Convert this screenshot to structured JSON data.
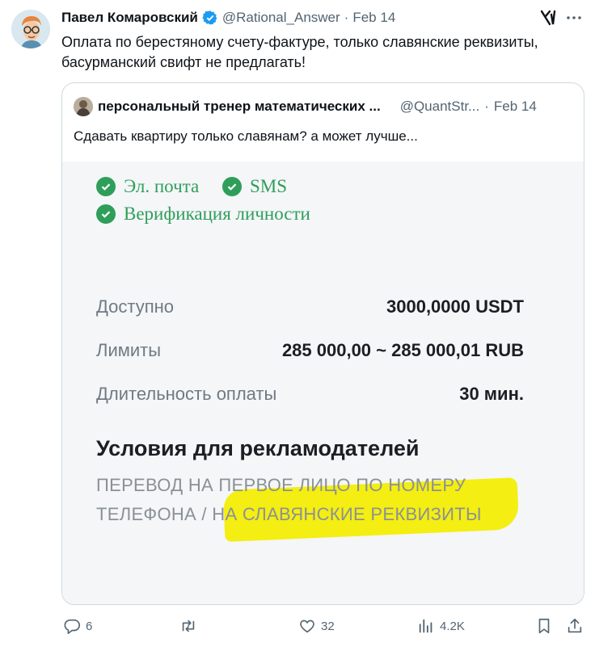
{
  "tweet": {
    "author_name": "Павел Комаровский",
    "handle": "@Rational_Answer",
    "separator": "·",
    "date": "Feb 14",
    "text": "Оплата по берестяному счету-фактуре, только славянские реквизиты, басурманский свифт не предлагать!"
  },
  "quote": {
    "author_name": "персональный тренер математических ...",
    "handle": "@QuantStr...",
    "separator": "·",
    "date": "Feb 14",
    "text": "Сдавать квартиру только славянам? а может лучше..."
  },
  "media": {
    "checks": [
      "Эл. почта",
      "SMS",
      "Верификация личности"
    ],
    "rows": [
      {
        "label": "Доступно",
        "value": "3000,0000 USDT"
      },
      {
        "label": "Лимиты",
        "value": "285 000,00 ~ 285 000,01 RUB"
      },
      {
        "label": "Длительность оплаты",
        "value": "30 мин."
      }
    ],
    "conditions_title": "Условия для рекламодателей",
    "conditions_line1": "ПЕРЕВОД НА ПЕРВОЕ ЛИЦО ПО НОМЕРУ",
    "conditions_line2": "ТЕЛЕФОНА / НА СЛАВЯНСКИЕ РЕКВИЗИТЫ",
    "highlight_color": "#f4ee12",
    "check_color": "#2f9e5a"
  },
  "actions": {
    "replies": "6",
    "likes": "32",
    "views": "4.2K"
  },
  "icons": {
    "verified": "verified-badge-icon",
    "grok": "grok-icon",
    "more": "more-icon",
    "reply": "reply-icon",
    "retweet": "retweet-icon",
    "like": "heart-icon",
    "views": "views-icon",
    "bookmark": "bookmark-icon",
    "share": "share-icon"
  },
  "colors": {
    "accent": "#1d9bf0",
    "muted": "#536471",
    "border": "#cfd9de"
  }
}
